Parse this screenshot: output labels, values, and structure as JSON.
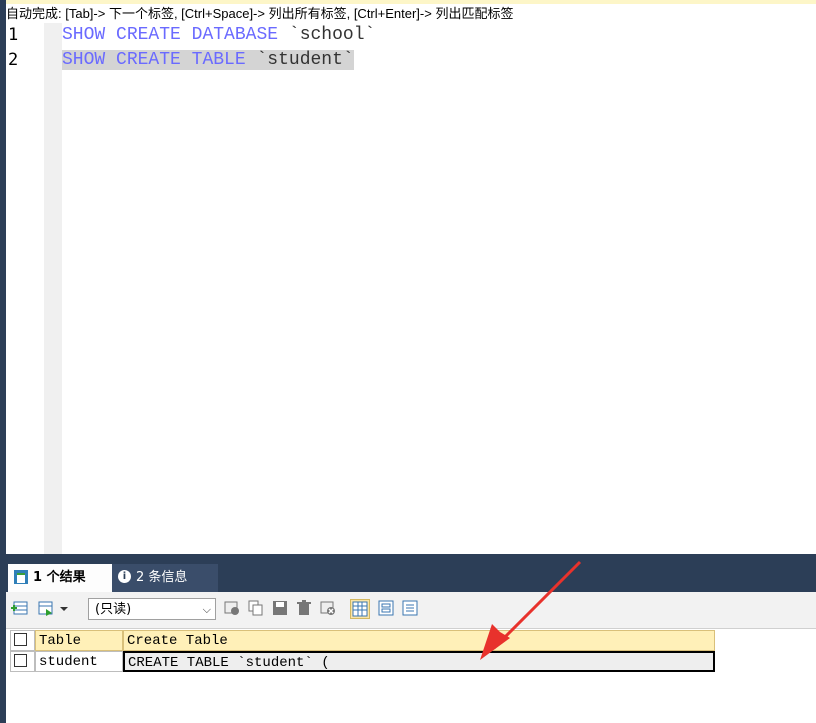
{
  "hint_bar": {
    "text": "自动完成: [Tab]-> 下一个标签, [Ctrl+Space]-> 列出所有标签, [Ctrl+Enter]-> 列出匹配标签"
  },
  "editor": {
    "lines": [
      {
        "number": "1",
        "kw1": "SHOW",
        "kw2": "CREATE",
        "kw3": "DATABASE",
        "name": "`school`"
      },
      {
        "number": "2",
        "kw1": "SHOW",
        "kw2": "CREATE",
        "kw3": "TABLE",
        "name": "`student`"
      }
    ]
  },
  "tabs": {
    "results_label": "1 个结果",
    "info_label": "2 条信息",
    "info_icon": "i"
  },
  "toolbar": {
    "readonly_value": "(只读)",
    "icons": [
      "add-row-icon",
      "export-icon",
      "refresh-icon",
      "copy-icon",
      "save-icon",
      "delete-icon",
      "cancel-icon",
      "grid-view-icon",
      "form-view-icon",
      "text-view-icon"
    ]
  },
  "grid": {
    "headers": [
      "Table",
      "Create Table"
    ],
    "rows": [
      {
        "table": "student",
        "create_table": "CREATE TABLE `student` ("
      }
    ]
  },
  "colors": {
    "keyword": "#6a6aff",
    "panel_dark": "#2c3e57",
    "header_yellow": "#fff0b8",
    "arrow_red": "#e8322c"
  }
}
